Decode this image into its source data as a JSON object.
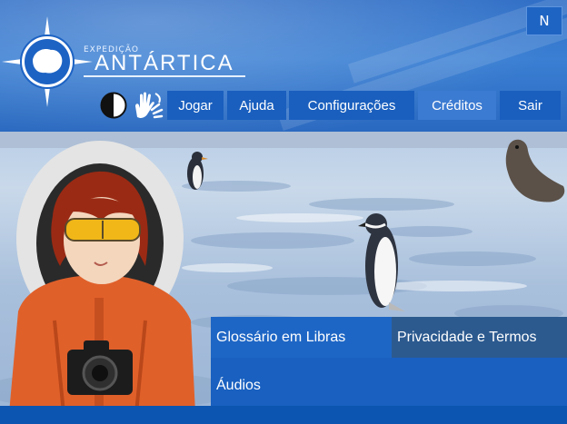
{
  "app": {
    "logo_small": "EXPEDIÇÃO",
    "logo_big": "ANTÁRTICA"
  },
  "header": {
    "language_button": "N"
  },
  "nav": {
    "items": [
      {
        "label": "Jogar"
      },
      {
        "label": "Ajuda"
      },
      {
        "label": "Configurações"
      },
      {
        "label": "Créditos"
      },
      {
        "label": "Sair"
      }
    ]
  },
  "panels": {
    "glossary": "Glossário em Libras",
    "privacy": "Privacidade e Termos",
    "audios": "Áudios"
  },
  "colors": {
    "header_blue": "#2f6ec6",
    "button_blue": "#1a5fbe",
    "button_active": "#3c7bd2",
    "panel_blue": "#1e66c5",
    "panel_dark": "#2c5a8f"
  },
  "icons": {
    "contrast": "contrast-icon",
    "libras": "sign-language-icon",
    "compass": "compass-logo-icon"
  }
}
